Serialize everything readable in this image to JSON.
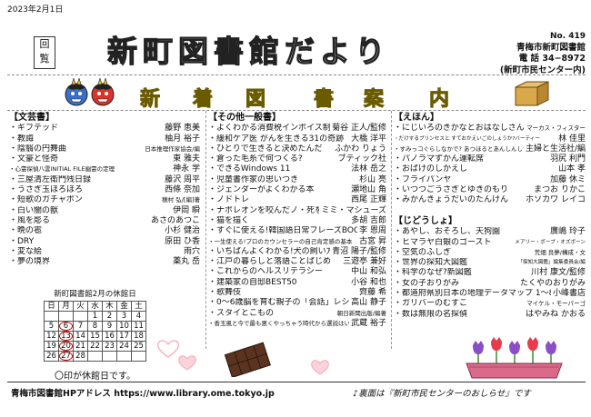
{
  "header": {
    "date": "2023年2月1日",
    "kairan": [
      "回",
      "覧"
    ],
    "title": "新町図書館だより",
    "vol": "No. 419",
    "library": "青梅市新町図書館",
    "tel": "電 話 34−8972",
    "center": "(新町市民センター内)"
  },
  "banner": [
    "新",
    "着",
    "図",
    "書",
    "案",
    "内"
  ],
  "bunge": {
    "heading": "【文芸書】",
    "rows": [
      {
        "t": "・ギフテッド",
        "a": "藤野 恵美"
      },
      {
        "t": "・教誨",
        "a": "柚月 裕子"
      },
      {
        "t": "・陰翳の円舞曲",
        "a": "日本推理作家協会/編"
      },
      {
        "t": "・文豪と怪奇",
        "a": "東 雅夫"
      },
      {
        "t": "・心霊探偵八雲INITIAL FILE幽霊の定理",
        "a": "神永 学"
      },
      {
        "t": "・三屋清左衛門残日録",
        "a": "藤沢 周平"
      },
      {
        "t": "・うさぎ玉ほろほろ",
        "a": "西條 奈加"
      },
      {
        "t": "・短歌のガチャポン",
        "a": "穂村 弘/[編]著"
      },
      {
        "t": "・白い闇の獣",
        "a": "伊岡 瞬"
      },
      {
        "t": "・風を彫る",
        "a": "あさのあつこ"
      },
      {
        "t": "・晩の雹",
        "a": "小杉 健治"
      },
      {
        "t": "・DRY",
        "a": "原田 ひ香"
      },
      {
        "t": "・変な絵",
        "a": "雨穴"
      },
      {
        "t": "・夢の境界",
        "a": "薬丸 岳"
      }
    ]
  },
  "calendar": {
    "title": "新町図書館2月の休館日",
    "days": [
      "日",
      "月",
      "火",
      "水",
      "木",
      "金",
      "土"
    ],
    "weeks": [
      [
        "",
        "",
        "",
        "1",
        "2",
        "3",
        "4"
      ],
      [
        "5",
        "6",
        "7",
        "8",
        "9",
        "10",
        "11"
      ],
      [
        "12",
        "13",
        "14",
        "15",
        "16",
        "17",
        "18"
      ],
      [
        "19",
        "20",
        "21",
        "22",
        "23",
        "24",
        "25"
      ],
      [
        "26",
        "27",
        "28",
        "",
        "",
        "",
        ""
      ]
    ],
    "closed": [
      "6",
      "13",
      "20",
      "27"
    ],
    "note": "〇印が休館日です。"
  },
  "ippan": {
    "heading": "【その他一般書】",
    "rows": [
      {
        "t": "・よくわかる消費税インボイス制度",
        "a": "菊谷 正人/監修"
      },
      {
        "t": "・緩和ケア医 がんを生きる31の奇跡",
        "a": "大橋 洋平"
      },
      {
        "t": "・ひとりで生きると決めたんだ",
        "a": "ふかわ りょう"
      },
      {
        "t": "・倉った毛糸で何つくる?",
        "a": "ブティック社"
      },
      {
        "t": "・できるWindows 11",
        "a": "法林 岳之"
      },
      {
        "t": "・児童書作家の思いつき",
        "a": "杉山 亮"
      },
      {
        "t": "・ジェンダーがよくわかる本",
        "a": "瀬地山 角"
      },
      {
        "t": "・ノドトレ",
        "a": "西尾 正輝"
      },
      {
        "t": "・ナポレオンを咬んだノ・死を嗅ぐ猫",
        "a": "ミミ・マシューズ"
      },
      {
        "t": "・猫を描く",
        "a": "多胡 吉郎"
      },
      {
        "t": "・すぐに使える!韓国語日常フレーズBOOK",
        "a": "李 恩周"
      },
      {
        "t": "・一生使える!プロのカウンセラーの自己肯定感の基本",
        "a": "古宮 昇"
      },
      {
        "t": "・いちばんよくわかる!犬の飼い方・暮らし方",
        "a": "青沼 陽子/監修"
      },
      {
        "t": "・江戸の暮らしと落語ことばじめ",
        "a": "三遊亭 兼好"
      },
      {
        "t": "・これからのヘルスリテラシー",
        "a": "中山 和弘"
      },
      {
        "t": "・建築家の自邸BEST50",
        "a": "小谷 和也"
      },
      {
        "t": "・歌舞伎",
        "a": "齊藤 希"
      },
      {
        "t": "・0〜6歳脳を育む親子の「会話」レシピ",
        "a": "高山 静子"
      },
      {
        "t": "・スタイとこもの",
        "a": "朝日新聞出版/編著"
      },
      {
        "t": "・香玉風と今で最も悪くやっちゃう時代から選説はい",
        "a": "武蔵 裕子"
      }
    ]
  },
  "ehon": {
    "heading": "【えほん】",
    "rows": [
      {
        "t": "・にじいろのきかなとおはなしさん",
        "a": "マーカス・フィスター"
      },
      {
        "t": "・だけするプリンセスと すておかえいごのしょうか?バーティー",
        "a": "林 佳里"
      },
      {
        "t": "・すみっコぐらしなかで? あつほるとあんしんしてす編",
        "a": "主婦と生活社/編"
      },
      {
        "t": "・パノラマずかん運転席",
        "a": "羽尻 利門"
      },
      {
        "t": "・おばけのしかえし",
        "a": "山本 孝"
      },
      {
        "t": "・フライパンヤ",
        "a": "加藤 休ミ"
      },
      {
        "t": "・いつつごうさぎとゆきのもり",
        "a": "まつお りかこ"
      },
      {
        "t": "・みかんきょうだいのたんけん",
        "a": "ホソカワ レイコ"
      }
    ]
  },
  "jido": {
    "heading": "【じどうしょ】",
    "rows": [
      {
        "t": "・あやし、おそろし、天狗園",
        "a": "廣嶋 玲子"
      },
      {
        "t": "・ヒマラヤ白銀のゴースト",
        "a": "メアリー・ポープ・オズボーン"
      },
      {
        "t": "・空気のふしぎ",
        "a": "荒畑 良夢/構成・文"
      },
      {
        "t": "・世界の探知大図鑑",
        "a": "「探知大図鑑」編集委員会/編"
      },
      {
        "t": "・科学のなぜ?新図鑑",
        "a": "川村 康文/監修"
      },
      {
        "t": "・女の子おりがみ",
        "a": "たくやのおりがみ"
      },
      {
        "t": "・都道府県別日本の地理データマップ 1〜8",
        "a": "小峰書店"
      },
      {
        "t": "・ガリバーのむすこ",
        "a": "マイケル・モーパーゴ"
      },
      {
        "t": "・数は無限の名探偵",
        "a": "はやみね かおる"
      }
    ]
  },
  "footer": {
    "left": "青梅市図書館HPアドレス https://www.library.ome.tokyo.jp",
    "right": "♪裏面は『新町市民センターのおしらせ』です"
  },
  "colors": {
    "banner": "#e8d820",
    "oni_blue": "#3a6fc8",
    "oni_red": "#d8342c",
    "heart": "#f4a8b8",
    "tulip_red": "#e83a4a",
    "tulip_purple": "#8a4ec8",
    "planter": "#d96a8a",
    "masu": "#d9a84a"
  },
  "icons": [
    "oni-blue-icon",
    "oni-red-icon",
    "masu-box-icon",
    "tulip-planter-icon",
    "chocolate-icon",
    "heart-icon"
  ]
}
